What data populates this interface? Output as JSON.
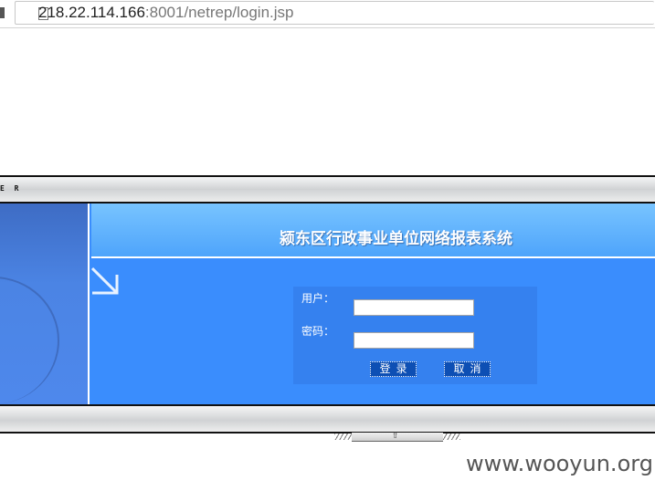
{
  "browser": {
    "url_host": "218.22.114.166",
    "url_rest": ":8001/netrep/login.jsp",
    "page_icon": "document-icon"
  },
  "banner": {
    "top_label": "E R"
  },
  "header": {
    "title": "颍东区行政事业单位网络报表系统"
  },
  "login": {
    "user_label": "用户：",
    "user_value": "",
    "password_label": "密码：",
    "password_value": "",
    "login_button": "登录",
    "cancel_button": "取消"
  },
  "watermark": "www.wooyun.org",
  "colors": {
    "panel_blue": "#3a8dfd",
    "header_blue": "#78c4ff",
    "button_blue": "#0d4fb4"
  }
}
